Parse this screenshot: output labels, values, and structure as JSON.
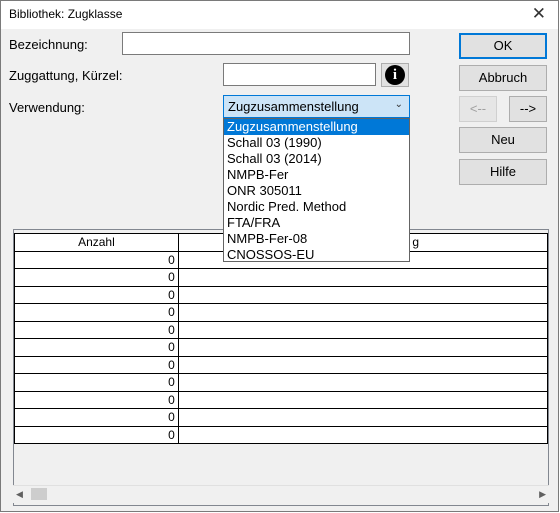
{
  "window": {
    "title": "Bibliothek: Zugklasse",
    "close": "✕"
  },
  "form": {
    "bezeichnung_label": "Bezeichnung:",
    "bezeichnung_value": "",
    "kuerzel_label": "Zuggattung, Kürzel:",
    "kuerzel_value": "",
    "verwendung_label": "Verwendung:",
    "verwendung_value": "Zugzusammenstellung"
  },
  "dropdown": {
    "options": [
      "Zugzusammenstellung",
      "Schall 03 (1990)",
      "Schall 03 (2014)",
      "NMPB-Fer",
      "ONR 305011",
      "Nordic Pred. Method",
      "FTA/FRA",
      "NMPB-Fer-08",
      "CNOSSOS-EU"
    ],
    "selected_index": 0
  },
  "buttons": {
    "ok": "OK",
    "abbruch": "Abbruch",
    "prev": "<--",
    "next": "-->",
    "neu": "Neu",
    "hilfe": "Hilfe",
    "info": "i"
  },
  "table": {
    "columns": [
      "Anzahl",
      "g"
    ],
    "rows": [
      [
        "0",
        ""
      ],
      [
        "0",
        ""
      ],
      [
        "0",
        ""
      ],
      [
        "0",
        ""
      ],
      [
        "0",
        ""
      ],
      [
        "0",
        ""
      ],
      [
        "0",
        ""
      ],
      [
        "0",
        ""
      ],
      [
        "0",
        ""
      ],
      [
        "0",
        ""
      ],
      [
        "0",
        ""
      ]
    ]
  },
  "icons": {
    "info": "info-icon",
    "dropdown": "chevron-down-icon",
    "scroll_left": "arrow-left-icon",
    "scroll_right": "arrow-right-icon"
  }
}
